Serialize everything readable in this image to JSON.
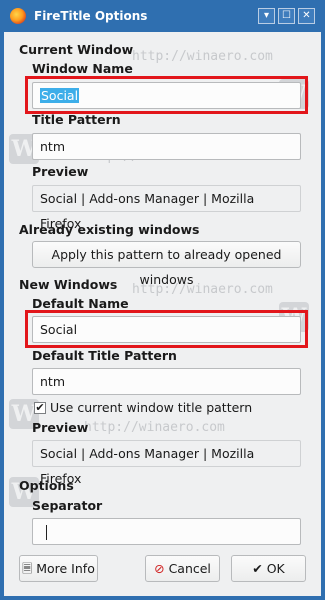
{
  "window": {
    "title": "FireTitle Options",
    "controls": [
      "▾",
      "☐",
      "✕"
    ]
  },
  "watermark_text": "http://winaero.com",
  "watermark_logo": "W",
  "current_window": {
    "heading": "Current Window",
    "window_name_label": "Window Name",
    "window_name_value": "Social",
    "title_pattern_label": "Title Pattern",
    "title_pattern_value": "ntm",
    "preview_label": "Preview",
    "preview_value": "Social | Add-ons Manager | Mozilla Firefox"
  },
  "existing_windows": {
    "heading": "Already existing windows",
    "apply_button": "Apply this pattern to already opened windows"
  },
  "new_windows": {
    "heading": "New Windows",
    "default_name_label": "Default Name",
    "default_name_value": "Social",
    "default_title_pattern_label": "Default Title Pattern",
    "default_title_pattern_value": "ntm",
    "use_current_label": "Use current window title pattern",
    "use_current_checked": true,
    "preview_label": "Preview",
    "preview_value": "Social | Add-ons Manager | Mozilla Firefox"
  },
  "options": {
    "heading": "Options",
    "separator_label": "Separator",
    "separator_value": ""
  },
  "buttons": {
    "more_info": "More Info",
    "cancel": "Cancel",
    "ok": "OK"
  },
  "colors": {
    "titlebar": "#2f6fb0",
    "highlight": "#e2161b",
    "selection": "#3daee9"
  }
}
